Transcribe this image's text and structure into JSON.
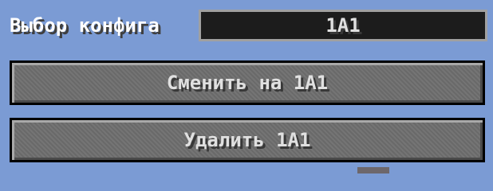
{
  "config_selector": {
    "label": "Выбор конфига",
    "value": "1A1"
  },
  "buttons": {
    "switch_label": "Сменить на 1A1",
    "delete_label": "Удалить 1A1"
  },
  "colors": {
    "background": "#7b9bd4",
    "button": "#6f6f6f",
    "field": "#1c1c1c",
    "text": "#e0e0e0"
  }
}
